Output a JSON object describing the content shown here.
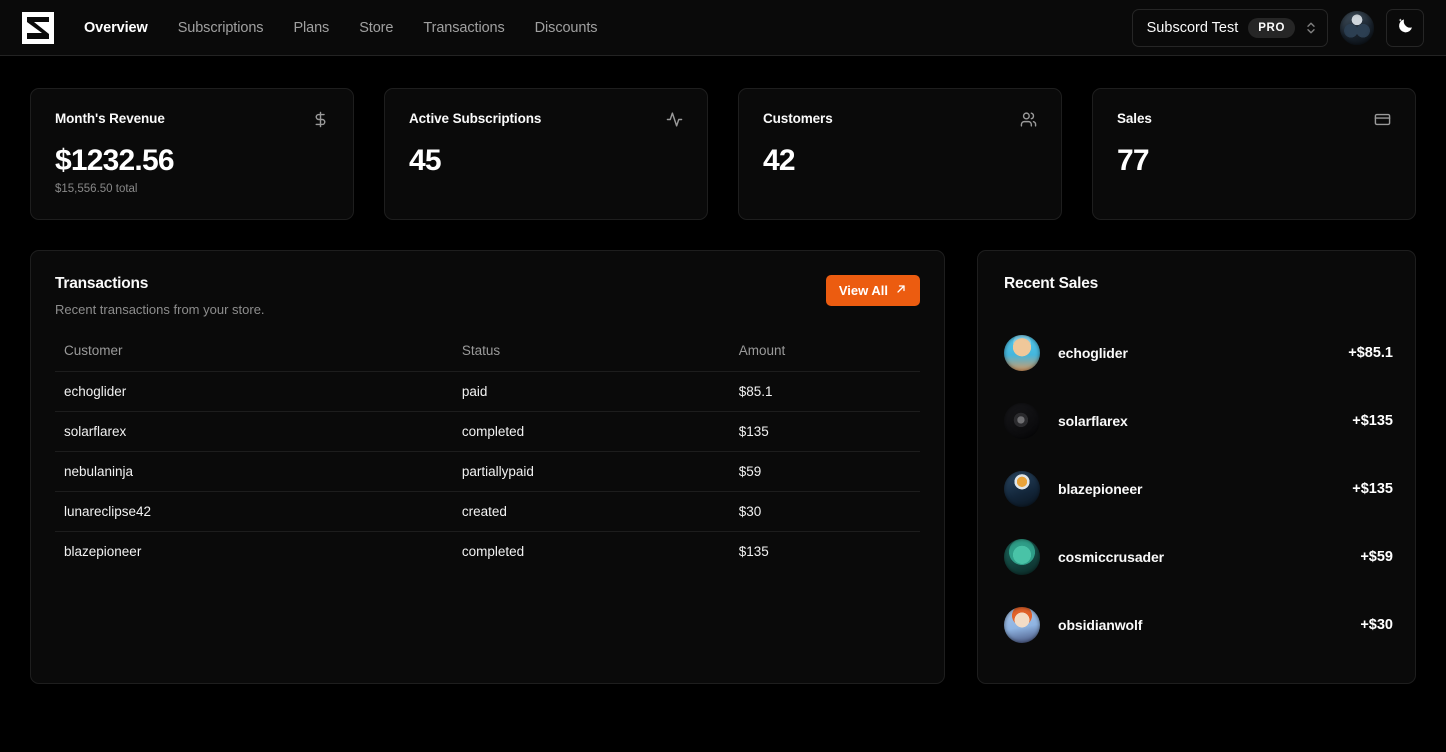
{
  "header": {
    "logo_icon": "subscord-logo-icon",
    "nav": [
      {
        "label": "Overview",
        "active": true
      },
      {
        "label": "Subscriptions",
        "active": false
      },
      {
        "label": "Plans",
        "active": false
      },
      {
        "label": "Store",
        "active": false
      },
      {
        "label": "Transactions",
        "active": false
      },
      {
        "label": "Discounts",
        "active": false
      }
    ],
    "team_switcher": {
      "name": "Subscord Test",
      "badge": "PRO",
      "chevron_icon": "chevron-up-down-icon"
    },
    "avatar_icon": "user-avatar",
    "theme_toggle_icon": "moon-stars-icon"
  },
  "stats": [
    {
      "title": "Month's Revenue",
      "value": "$1232.56",
      "sub": "$15,556.50 total",
      "icon": "dollar-sign-icon"
    },
    {
      "title": "Active Subscriptions",
      "value": "45",
      "sub": "",
      "icon": "activity-pulse-icon"
    },
    {
      "title": "Customers",
      "value": "42",
      "sub": "",
      "icon": "users-icon"
    },
    {
      "title": "Sales",
      "value": "77",
      "sub": "",
      "icon": "credit-card-icon"
    }
  ],
  "transactions": {
    "title": "Transactions",
    "description": "Recent transactions from your store.",
    "view_all_label": "View All",
    "view_all_icon": "arrow-up-right-icon",
    "columns": [
      "Customer",
      "Status",
      "Amount"
    ],
    "rows": [
      {
        "customer": "echoglider",
        "status": "paid",
        "amount": "$85.1"
      },
      {
        "customer": "solarflarex",
        "status": "completed",
        "amount": "$135"
      },
      {
        "customer": "nebulaninja",
        "status": "partiallypaid",
        "amount": "$59"
      },
      {
        "customer": "lunareclipse42",
        "status": "created",
        "amount": "$30"
      },
      {
        "customer": "blazepioneer",
        "status": "completed",
        "amount": "$135"
      }
    ]
  },
  "recent_sales": {
    "title": "Recent Sales",
    "rows": [
      {
        "name": "echoglider",
        "amount": "+$85.1"
      },
      {
        "name": "solarflarex",
        "amount": "+$135"
      },
      {
        "name": "blazepioneer",
        "amount": "+$135"
      },
      {
        "name": "cosmiccrusader",
        "amount": "+$59"
      },
      {
        "name": "obsidianwolf",
        "amount": "+$30"
      }
    ]
  },
  "colors": {
    "background": "#000000",
    "card": "#0a0a0a",
    "border": "#1e1e1e",
    "accent": "#ec5c10",
    "text": "#fafafa",
    "muted": "#8d8d8d"
  }
}
